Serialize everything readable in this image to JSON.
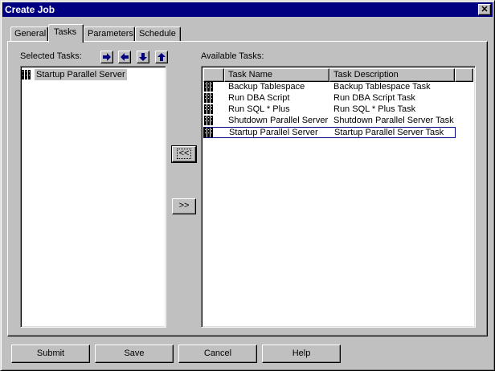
{
  "window": {
    "title": "Create Job",
    "close_glyph": "✕"
  },
  "tabs": [
    {
      "label": "General",
      "active": false
    },
    {
      "label": "Tasks",
      "active": true
    },
    {
      "label": "Parameters",
      "active": false
    },
    {
      "label": "Schedule",
      "active": false
    }
  ],
  "selected_tasks": {
    "label": "Selected Tasks:",
    "items": [
      "Startup Parallel Server"
    ],
    "order_buttons": [
      "arrow-right-icon",
      "arrow-left-icon",
      "arrow-down-icon",
      "arrow-up-icon"
    ]
  },
  "available_tasks": {
    "label": "Available Tasks:",
    "columns": [
      "Task Name",
      "Task Description"
    ],
    "rows": [
      {
        "name": "Backup Tablespace",
        "description": "Backup Tablespace Task"
      },
      {
        "name": "Run DBA Script",
        "description": "Run DBA Script Task"
      },
      {
        "name": "Run SQL * Plus",
        "description": "Run SQL * Plus Task"
      },
      {
        "name": "Shutdown Parallel Server",
        "description": "Shutdown Parallel Server Task"
      },
      {
        "name": "Startup Parallel Server",
        "description": "Startup Parallel Server Task"
      }
    ]
  },
  "move_buttons": {
    "add": "<<",
    "remove": ">>"
  },
  "buttons": {
    "submit": "Submit",
    "save": "Save",
    "cancel": "Cancel",
    "help": "Help"
  },
  "colors": {
    "titlebar": "#000080",
    "face": "#c0c0c0",
    "arrow": "#000080"
  }
}
